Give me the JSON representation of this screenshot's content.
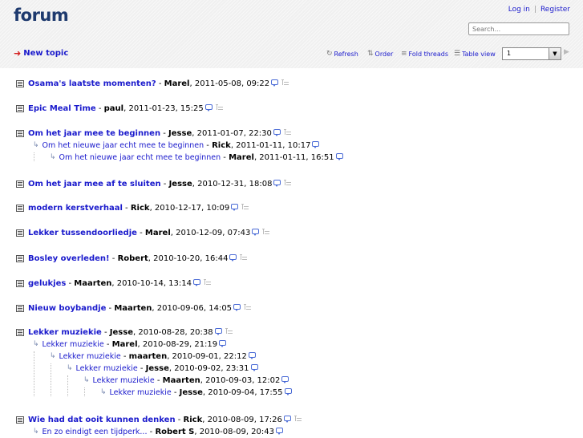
{
  "header": {
    "title": "forum",
    "login": "Log in",
    "separator": "|",
    "register": "Register",
    "search_placeholder": "Search..."
  },
  "toolbar": {
    "new_topic": "New topic",
    "refresh": "Refresh",
    "order": "Order",
    "fold_threads": "Fold threads",
    "table_view": "Table view",
    "page_value": "1"
  },
  "threads": [
    {
      "title": "Osama's laatste momenten?",
      "author": "Marel",
      "date": "2011-05-08, 09:22",
      "replies": []
    },
    {
      "title": "Epic Meal Time",
      "author": "paul",
      "date": "2011-01-23, 15:25",
      "replies": []
    },
    {
      "title": "Om het jaar mee te beginnen",
      "author": "Jesse",
      "date": "2011-01-07, 22:30",
      "replies": [
        {
          "title": "Om het nieuwe jaar echt mee te beginnen",
          "author": "Rick",
          "date": "2011-01-11, 10:17"
        },
        {
          "title": "Om het nieuwe jaar echt mee te beginnen",
          "author": "Marel",
          "date": "2011-01-11, 16:51"
        }
      ]
    },
    {
      "title": "Om het jaar mee af te sluiten",
      "author": "Jesse",
      "date": "2010-12-31, 18:08",
      "replies": []
    },
    {
      "title": "modern kerstverhaal",
      "author": "Rick",
      "date": "2010-12-17, 10:09",
      "replies": []
    },
    {
      "title": "Lekker tussendoorliedje",
      "author": "Marel",
      "date": "2010-12-09, 07:43",
      "replies": []
    },
    {
      "title": "Bosley overleden!",
      "author": "Robert",
      "date": "2010-10-20, 16:44",
      "replies": []
    },
    {
      "title": "gelukjes",
      "author": "Maarten",
      "date": "2010-10-14, 13:14",
      "replies": []
    },
    {
      "title": "Nieuw boybandje",
      "author": "Maarten",
      "date": "2010-09-06, 14:05",
      "replies": []
    },
    {
      "title": "Lekker muziekie",
      "author": "Jesse",
      "date": "2010-08-28, 20:38",
      "replies": [
        {
          "title": "Lekker muziekie",
          "author": "Marel",
          "date": "2010-08-29, 21:19"
        },
        {
          "title": "Lekker muziekie",
          "author": "maarten",
          "date": "2010-09-01, 22:12"
        },
        {
          "title": "Lekker muziekie",
          "author": "Jesse",
          "date": "2010-09-02, 23:31"
        },
        {
          "title": "Lekker muziekie",
          "author": "Maarten",
          "date": "2010-09-03, 12:02"
        },
        {
          "title": "Lekker muziekie",
          "author": "Jesse",
          "date": "2010-09-04, 17:55"
        }
      ]
    },
    {
      "title": "Wie had dat ooit kunnen denken",
      "author": "Rick",
      "date": "2010-08-09, 17:26",
      "replies": [
        {
          "title": "En zo eindigt een tijdperk...",
          "author": "Robert S",
          "date": "2010-08-09, 20:43"
        }
      ]
    }
  ],
  "colors": {
    "link": "#1a1acc",
    "title": "#1e3a6e",
    "arrow": "#d42020"
  }
}
